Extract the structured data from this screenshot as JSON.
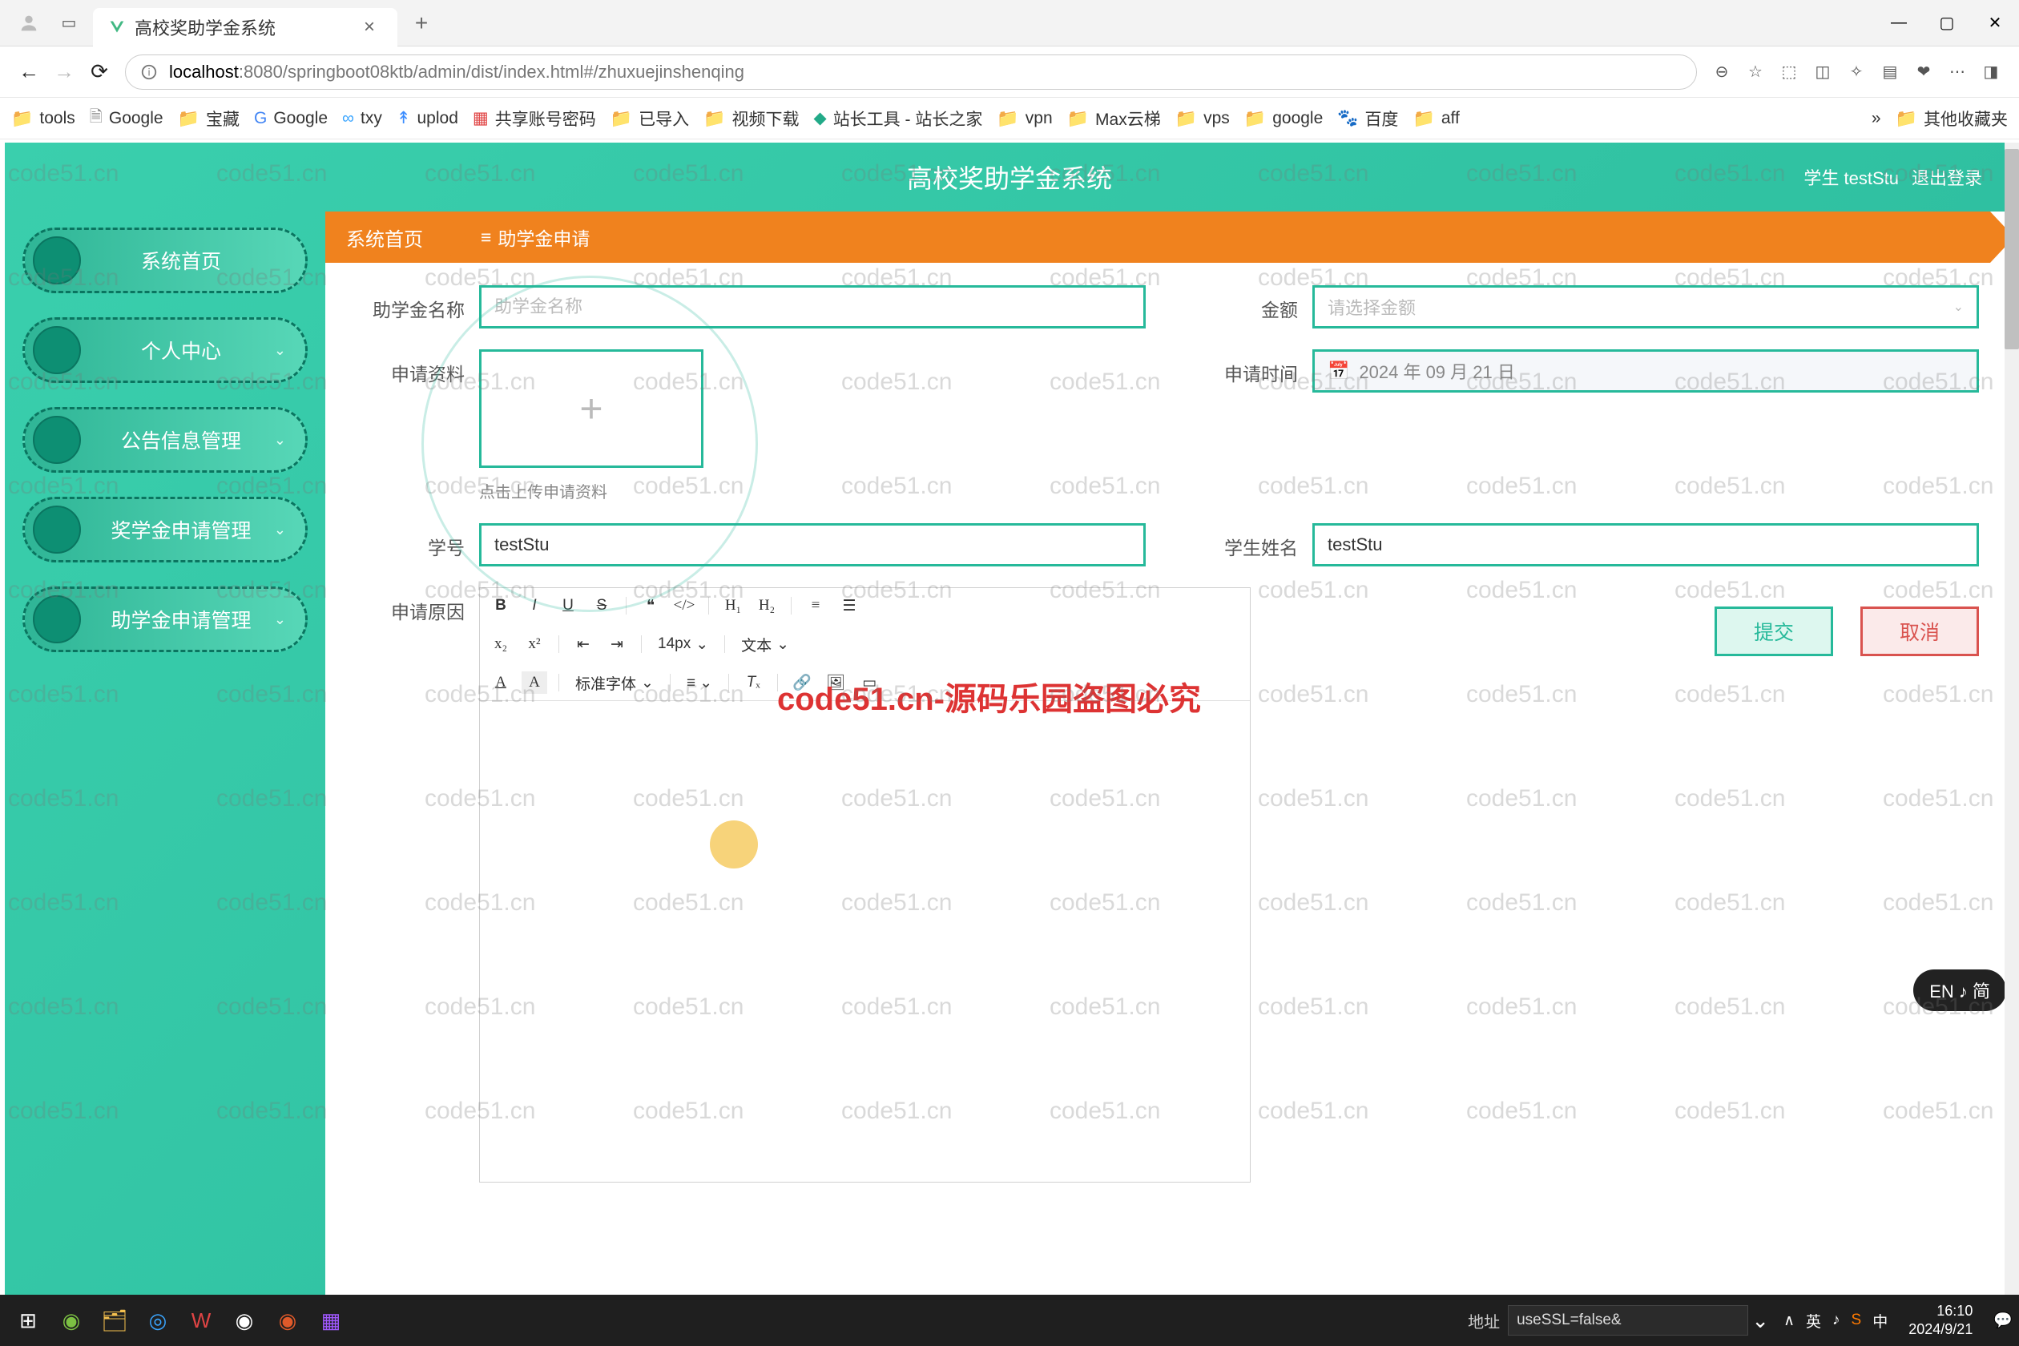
{
  "browser": {
    "tab_title": "高校奖助学金系统",
    "url_host": "localhost",
    "url_port": ":8080",
    "url_path": "/springboot08ktb/admin/dist/index.html#/zhuxuejinshenqing",
    "bookmarks": [
      "tools",
      "Google",
      "宝藏",
      "Google",
      "txy",
      "uplod",
      "共享账号密码",
      "已导入",
      "视频下载",
      "站长工具 - 站长之家",
      "vpn",
      "Max云梯",
      "vps",
      "google",
      "百度",
      "aff",
      "其他收藏夹"
    ]
  },
  "app": {
    "title": "高校奖助学金系统",
    "user_role": "学生 testStu",
    "logout": "退出登录",
    "breadcrumb_home": "系统首页",
    "breadcrumb_current": "助学金申请",
    "sidebar": [
      {
        "label": "系统首页",
        "expandable": false
      },
      {
        "label": "个人中心",
        "expandable": true
      },
      {
        "label": "公告信息管理",
        "expandable": true
      },
      {
        "label": "奖学金申请管理",
        "expandable": true
      },
      {
        "label": "助学金申请管理",
        "expandable": true
      }
    ],
    "form": {
      "name_label": "助学金名称",
      "name_placeholder": "助学金名称",
      "amount_label": "金额",
      "amount_placeholder": "请选择金额",
      "material_label": "申请资料",
      "material_hint": "点击上传申请资料",
      "time_label": "申请时间",
      "time_value": "2024 年 09 月 21 日",
      "sid_label": "学号",
      "sid_value": "testStu",
      "sname_label": "学生姓名",
      "sname_value": "testStu",
      "reason_label": "申请原因",
      "editor_fontsize": "14px",
      "editor_fontstyle": "文本",
      "editor_fontfamily": "标准字体",
      "submit": "提交",
      "cancel": "取消"
    }
  },
  "watermark": "code51.cn",
  "banner": "code51.cn-源码乐园盗图必究",
  "taskbar": {
    "addr_label": "地址",
    "addr_value": "useSSL=false&",
    "lang": "英",
    "ime": "中",
    "time": "16:10",
    "date": "2024/9/21"
  },
  "lang_pill": "EN ♪ 简"
}
